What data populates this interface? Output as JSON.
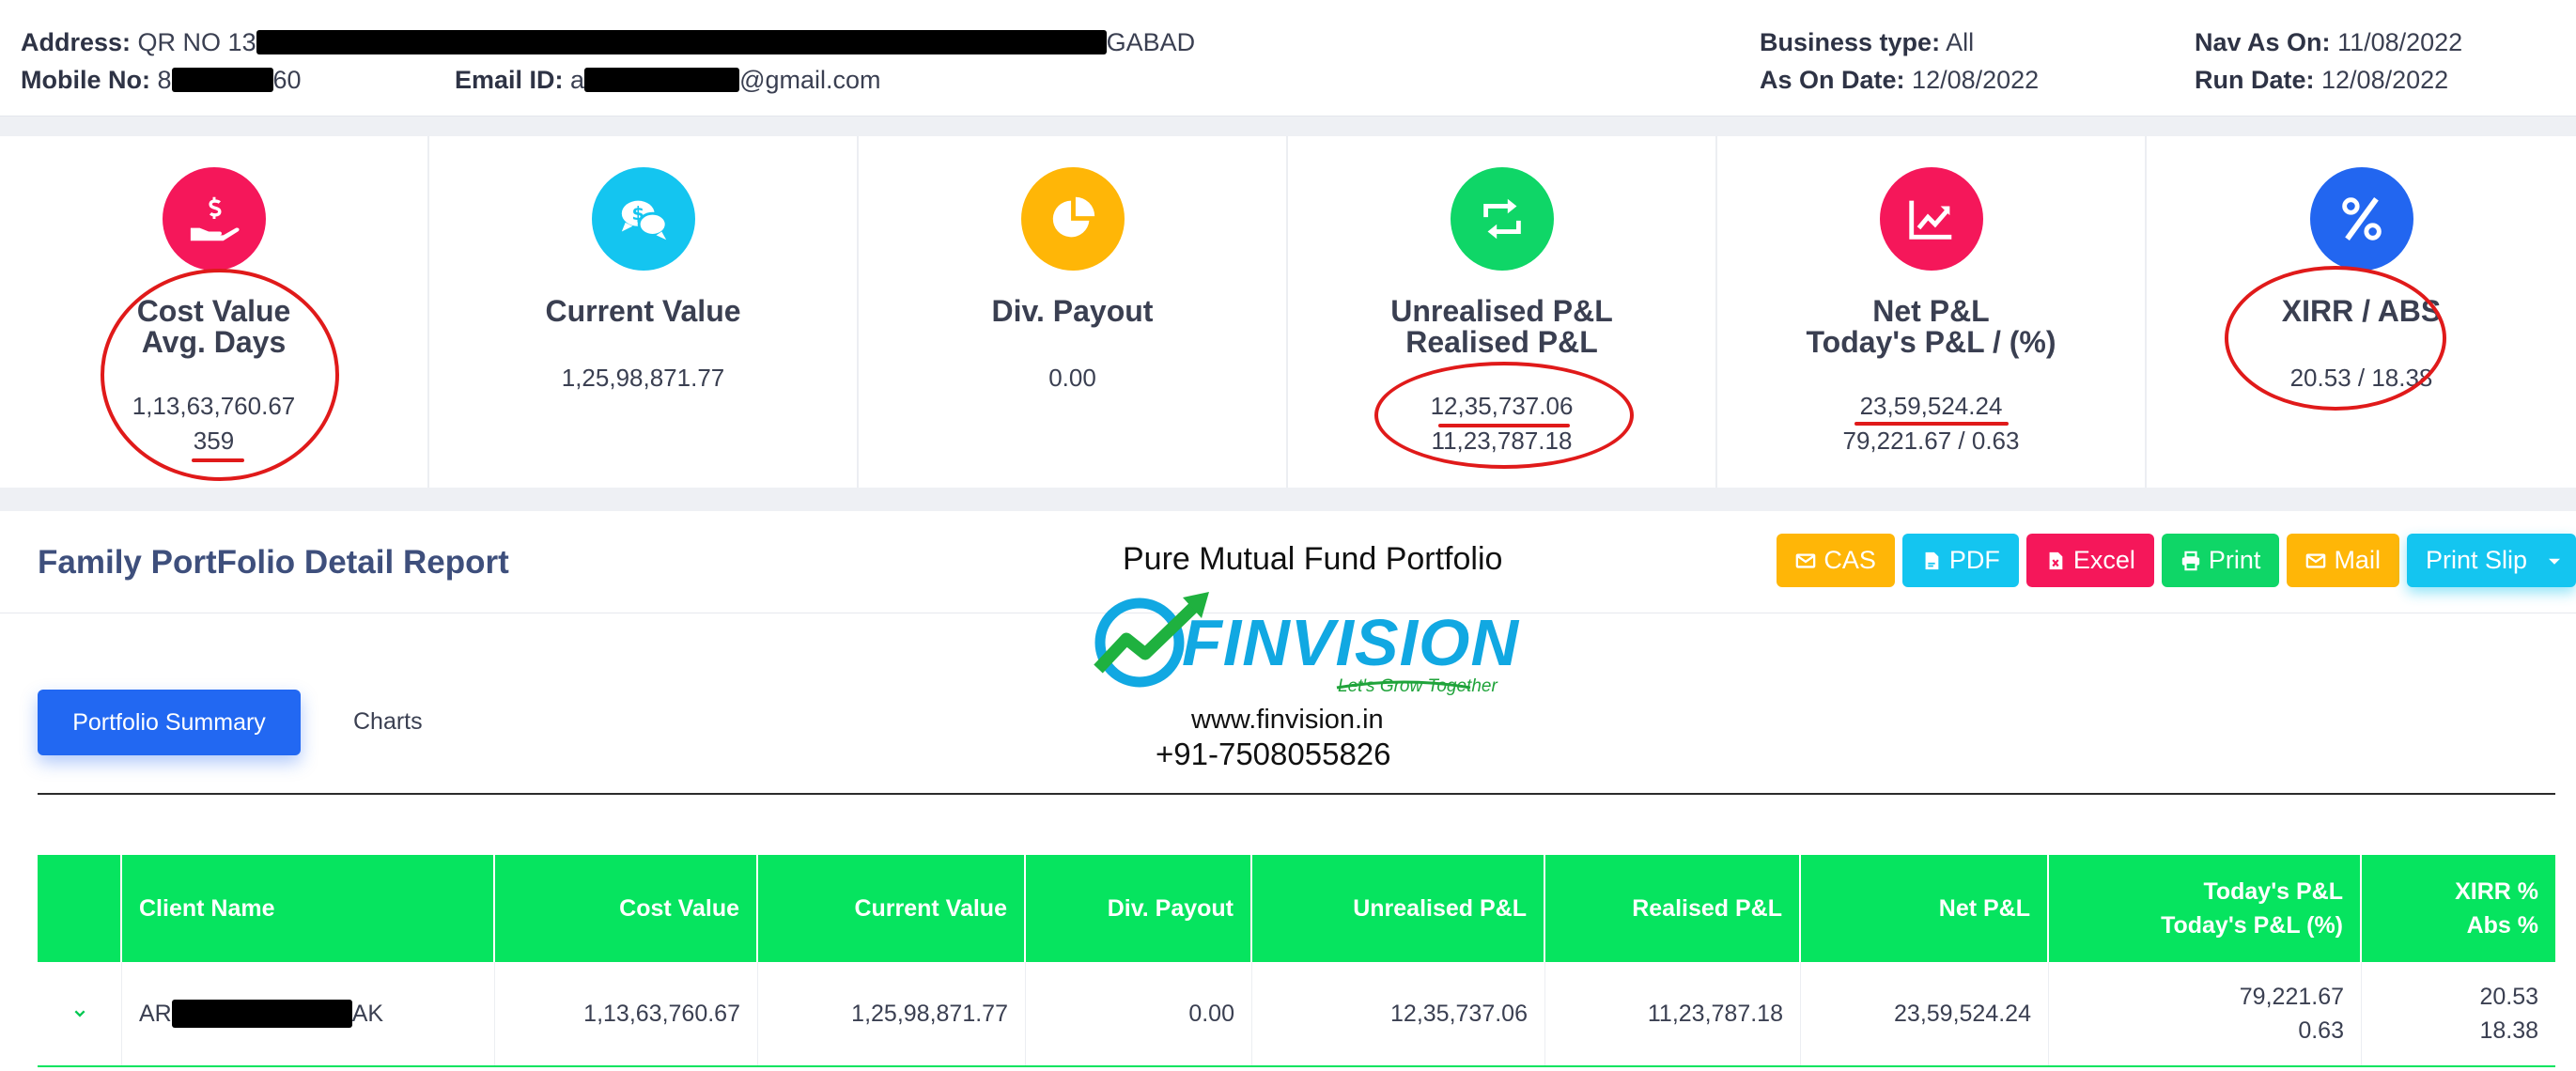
{
  "header": {
    "address_label": "Address:",
    "address_prefix": "QR NO 13",
    "address_suffix": "GABAD",
    "mobile_label": "Mobile No:",
    "mobile_prefix": "8",
    "mobile_suffix": "60",
    "email_label": "Email ID:",
    "email_prefix": "a",
    "email_suffix": "@gmail.com",
    "business_type_label": "Business type:",
    "business_type": "All",
    "as_on_date_label": "As On Date:",
    "as_on_date": "12/08/2022",
    "nav_as_on_label": "Nav As On:",
    "nav_as_on": "11/08/2022",
    "run_date_label": "Run Date:",
    "run_date": "12/08/2022"
  },
  "stats": [
    {
      "title1": "Cost Value",
      "title2": "Avg. Days",
      "value1": "1,13,63,760.67",
      "value2": "359",
      "icon": "hand-dollar-icon",
      "color": "#f5175a"
    },
    {
      "title1": "Current Value",
      "title2": "",
      "value1": "1,25,98,871.77",
      "value2": "",
      "icon": "chat-dollar-icon",
      "color": "#14c5f0"
    },
    {
      "title1": "Div. Payout",
      "title2": "",
      "value1": "0.00",
      "value2": "",
      "icon": "pie-chart-icon",
      "color": "#ffb607"
    },
    {
      "title1": "Unrealised P&L",
      "title2": "Realised P&L",
      "value1": "12,35,737.06",
      "value2": "11,23,787.18",
      "icon": "retweet-icon",
      "color": "#0fd667"
    },
    {
      "title1": "Net P&L",
      "title2": "Today's P&L / (%)",
      "value1": "23,59,524.24",
      "value2": "79,221.67 / 0.63",
      "icon": "chart-line-icon",
      "color": "#f5175a"
    },
    {
      "title1": "XIRR / ABS",
      "title2": "",
      "value1": "20.53 / 18.38",
      "value2": "",
      "icon": "percent-icon",
      "color": "#2266f0"
    }
  ],
  "report": {
    "title": "Family PortFolio Detail Report",
    "subtitle": "Pure Mutual Fund Portfolio",
    "buttons": [
      {
        "label": "CAS",
        "icon": "envelope-icon",
        "color": "#ffb607"
      },
      {
        "label": "PDF",
        "icon": "pdf-file-icon",
        "color": "#14c5f0"
      },
      {
        "label": "Excel",
        "icon": "excel-file-icon",
        "color": "#f5175a"
      },
      {
        "label": "Print",
        "icon": "printer-icon",
        "color": "#0fd667"
      },
      {
        "label": "Mail",
        "icon": "envelope-icon",
        "color": "#ffb607"
      },
      {
        "label": "Print Slip",
        "icon": "caret-down-icon",
        "color": "#14c5f0"
      }
    ]
  },
  "logo": {
    "brand": "FINVISION",
    "tagline": "Let's Grow Together",
    "website": "www.finvision.in",
    "phone": "+91-7508055826"
  },
  "tabs": {
    "summary": "Portfolio Summary",
    "charts": "Charts"
  },
  "table": {
    "headers": {
      "client": "Client Name",
      "cost": "Cost Value",
      "current": "Current Value",
      "div": "Div. Payout",
      "unrealised": "Unrealised P&L",
      "realised": "Realised P&L",
      "net": "Net P&L",
      "today1": "Today's P&L",
      "today2": "Today's P&L (%)",
      "xirr1": "XIRR %",
      "xirr2": "Abs %"
    },
    "rows": [
      {
        "client_prefix": "AR",
        "client_suffix": "AK",
        "cost": "1,13,63,760.67",
        "current": "1,25,98,871.77",
        "div": "0.00",
        "unrealised": "12,35,737.06",
        "realised": "11,23,787.18",
        "net": "23,59,524.24",
        "today_amt": "79,221.67",
        "today_pct": "0.63",
        "xirr": "20.53",
        "abs": "18.38"
      }
    ]
  }
}
